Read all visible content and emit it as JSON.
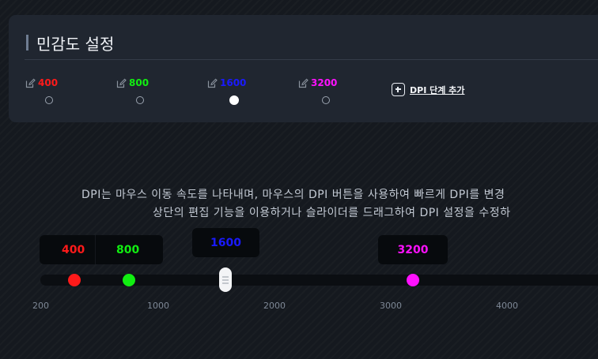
{
  "panel": {
    "title": "민감도 설정",
    "levels": [
      {
        "value": "400",
        "color": "#ff1a1a",
        "selected": false
      },
      {
        "value": "800",
        "color": "#11ee11",
        "selected": false
      },
      {
        "value": "1600",
        "color": "#1a1aff",
        "selected": true
      },
      {
        "value": "3200",
        "color": "#ff11ff",
        "selected": false
      }
    ],
    "add_stage_label": "DPI 단계 추가"
  },
  "description": {
    "line1": "DPI는 마우스 이동 속도를 나타내며, 마우스의 DPI 버튼을 사용하여 빠르게 DPI를 변경",
    "line2": "상단의 편집 기능을 이용하거나 슬라이더를 드래그하여 DPI 설정을 수정하"
  },
  "slider": {
    "badges": [
      {
        "value": "400",
        "color": "#ff1a1a"
      },
      {
        "value": "800",
        "color": "#11ee11"
      },
      {
        "value": "1600",
        "color": "#1a1aff"
      },
      {
        "value": "3200",
        "color": "#ff11ff"
      }
    ],
    "ticks": [
      "200",
      "1000",
      "2000",
      "3000",
      "4000"
    ]
  }
}
